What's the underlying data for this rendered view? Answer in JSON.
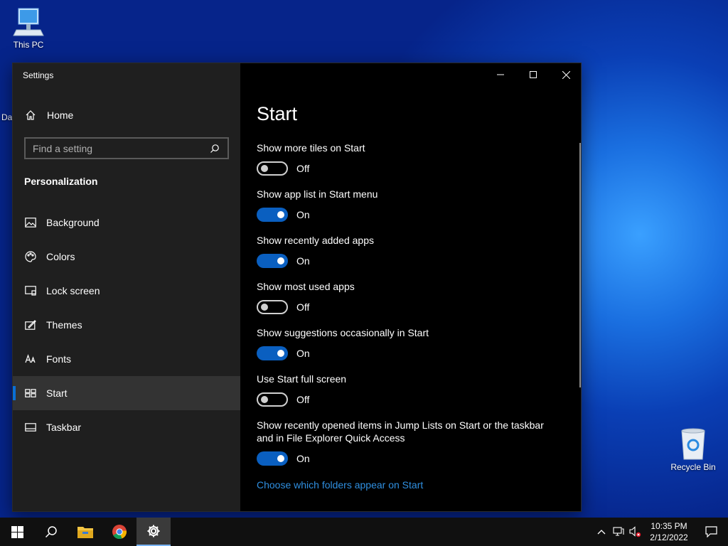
{
  "desktop": {
    "this_pc_label": "This PC",
    "recycle_bin_label": "Recycle Bin",
    "edge_fragment_1": "Da"
  },
  "window": {
    "title": "Settings",
    "controls": {
      "minimize": "minimize-icon",
      "maximize": "maximize-icon",
      "close": "close-icon"
    }
  },
  "sidebar": {
    "home_label": "Home",
    "search_placeholder": "Find a setting",
    "section_title": "Personalization",
    "items": [
      {
        "label": "Background",
        "icon": "picture-icon"
      },
      {
        "label": "Colors",
        "icon": "palette-icon"
      },
      {
        "label": "Lock screen",
        "icon": "lock-screen-icon"
      },
      {
        "label": "Themes",
        "icon": "themes-icon"
      },
      {
        "label": "Fonts",
        "icon": "fonts-icon"
      },
      {
        "label": "Start",
        "icon": "start-icon",
        "active": true
      },
      {
        "label": "Taskbar",
        "icon": "taskbar-icon"
      }
    ]
  },
  "content": {
    "title": "Start",
    "settings": [
      {
        "label": "Show more tiles on Start",
        "state": "Off"
      },
      {
        "label": "Show app list in Start menu",
        "state": "On"
      },
      {
        "label": "Show recently added apps",
        "state": "On"
      },
      {
        "label": "Show most used apps",
        "state": "Off"
      },
      {
        "label": "Show suggestions occasionally in Start",
        "state": "On"
      },
      {
        "label": "Use Start full screen",
        "state": "Off"
      },
      {
        "label_line1": "Show recently opened items in Jump Lists on Start or the taskbar",
        "label_line2": "and in File Explorer Quick Access",
        "state": "On"
      }
    ],
    "link": "Choose which folders appear on Start"
  },
  "taskbar": {
    "apps": [
      "start-icon",
      "search-icon",
      "file-explorer-icon",
      "chrome-icon",
      "settings-gear-icon"
    ],
    "clock": {
      "time": "10:35 PM",
      "date": "2/12/2022"
    }
  },
  "colors": {
    "accent": "#0a5fc0",
    "link": "#2f8fe0",
    "sidebar_bg": "#1f1f1f",
    "content_bg": "#000000"
  }
}
